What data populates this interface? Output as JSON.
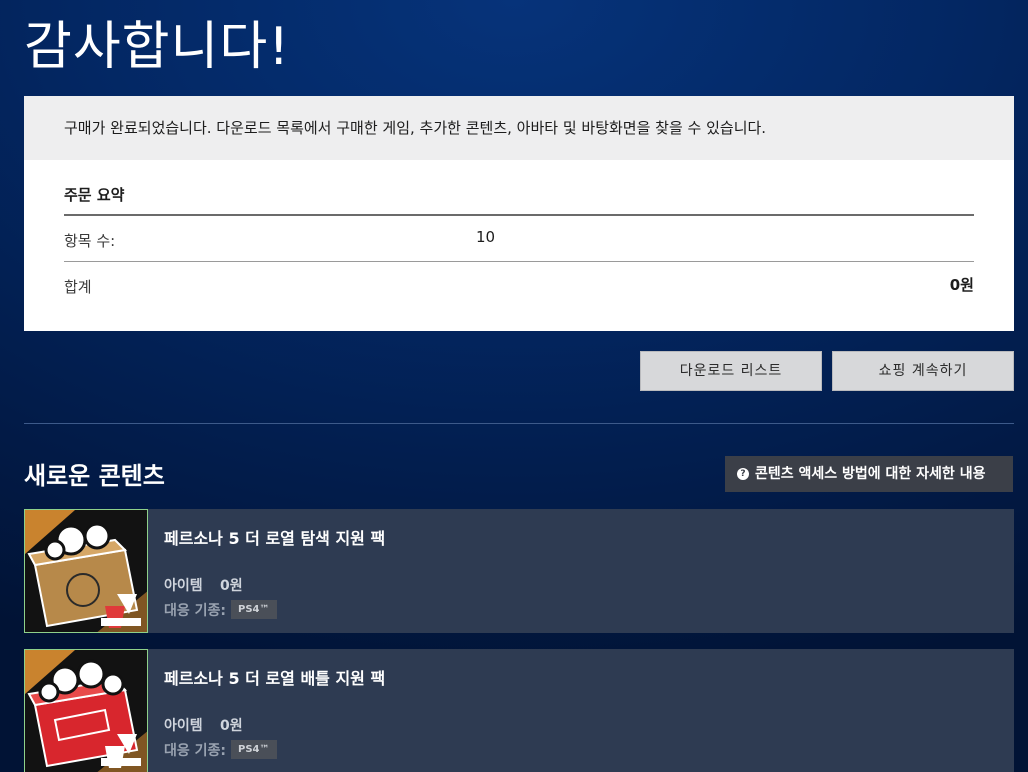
{
  "page": {
    "title": "감사합니다!"
  },
  "confirm": {
    "message": "구매가 완료되었습니다. 다운로드 목록에서 구매한 게임, 추가한 콘텐츠, 아바타 및 바탕화면을 찾을 수 있습니다.",
    "summary_title": "주문 요약",
    "items_label": "항목 수:",
    "items_count": "10",
    "total_label": "합계",
    "total_value": "0원"
  },
  "actions": {
    "download_list": "다운로드 리스트",
    "continue_shopping": "쇼핑 계속하기"
  },
  "new_content": {
    "title": "새로운 콘텐츠",
    "help_label": "콘텐츠 액세스 방법에 대한 자세한 내용",
    "items": [
      {
        "name": "페르소나 5 더 로열 탐색 지원 팩",
        "type": "아이템",
        "price": "0원",
        "platform_label": "대응 기종:",
        "platform": "PS4™"
      },
      {
        "name": "페르소나 5 더 로열 배틀 지원 팩",
        "type": "아이템",
        "price": "0원",
        "platform_label": "대응 기종:",
        "platform": "PS4™"
      }
    ]
  },
  "colors": {
    "background": "#032763",
    "panel": "#ffffff",
    "item_card": "#2e3b52",
    "thumb_accent_red": "#d8262d"
  }
}
